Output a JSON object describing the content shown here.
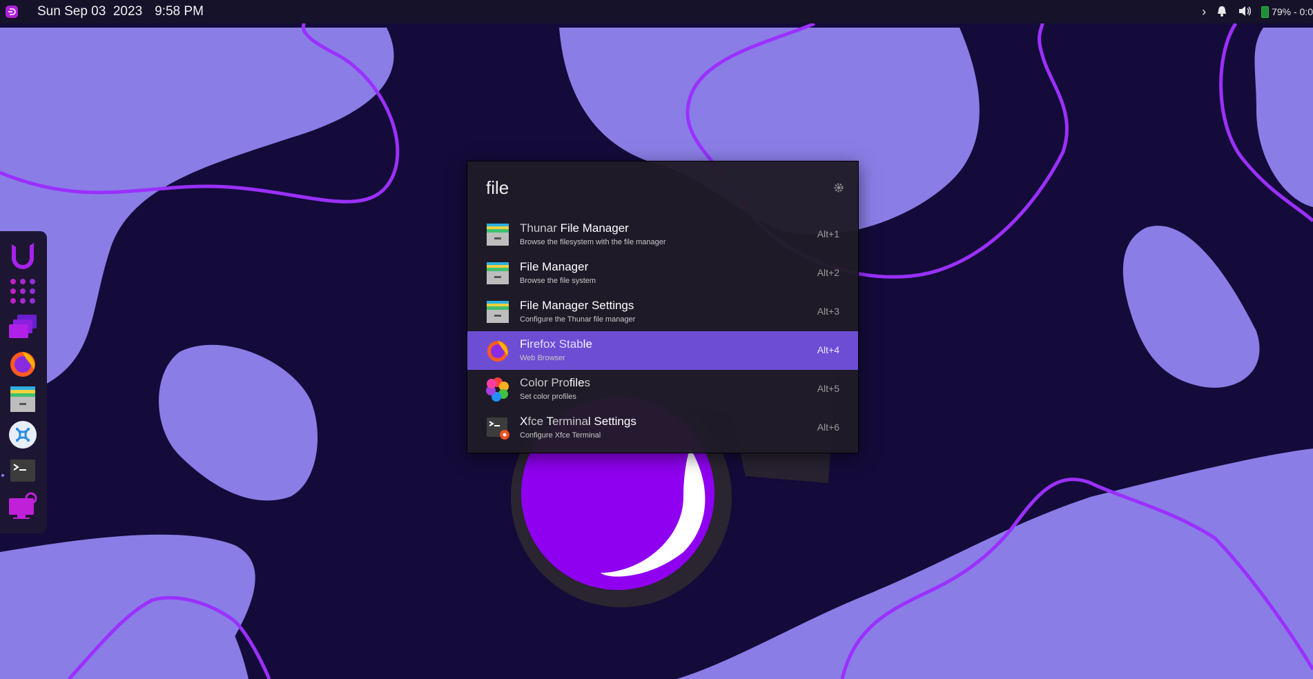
{
  "topbar": {
    "date": "Sun Sep 03  2023",
    "time": "9:58 PM",
    "battery": "79% - 0:0",
    "icons": [
      "menu-icon",
      "chevron-right-icon",
      "bell-icon",
      "volume-icon",
      "battery-icon"
    ]
  },
  "dock": {
    "items": [
      "ultramarine-logo-icon",
      "app-grid-icon",
      "workspaces-icon",
      "firefox-icon",
      "file-manager-icon",
      "settings-manager-icon",
      "terminal-icon",
      "display-settings-icon"
    ]
  },
  "launcher": {
    "query": "file",
    "settings_icon": "gear-icon",
    "results": [
      {
        "name_parts": [
          {
            "t": "Thunar ",
            "hl": false
          },
          {
            "t": "File",
            "hl": true
          },
          {
            "t": " ",
            "hl": false
          },
          {
            "t": "Manager",
            "hl": true
          }
        ],
        "desc": "Browse the filesystem with the file manager",
        "hotkey": "Alt+1",
        "icon": "file-manager-icon",
        "selected": false
      },
      {
        "name_parts": [
          {
            "t": "File",
            "hl": true
          },
          {
            "t": " ",
            "hl": false
          },
          {
            "t": "Manager",
            "hl": true
          }
        ],
        "desc": "Browse the file system",
        "hotkey": "Alt+2",
        "icon": "file-manager-icon",
        "selected": false
      },
      {
        "name_parts": [
          {
            "t": "File",
            "hl": true
          },
          {
            "t": " ",
            "hl": false
          },
          {
            "t": "Manager Settings",
            "hl": true
          }
        ],
        "desc": "Configure the Thunar file manager",
        "hotkey": "Alt+3",
        "icon": "file-manager-icon",
        "selected": false
      },
      {
        "name_parts": [
          {
            "t": "Fi",
            "hl": true
          },
          {
            "t": "refox Stab",
            "hl": false
          },
          {
            "t": "le",
            "hl": true
          }
        ],
        "desc": "Web Browser",
        "hotkey": "Alt+4",
        "icon": "firefox-icon",
        "selected": true
      },
      {
        "name_parts": [
          {
            "t": "Color Pro",
            "hl": false
          },
          {
            "t": "file",
            "hl": true
          },
          {
            "t": "s",
            "hl": false
          }
        ],
        "desc": "Set color profiles",
        "hotkey": "Alt+5",
        "icon": "color-profiles-icon",
        "selected": false
      },
      {
        "name_parts": [
          {
            "t": "X",
            "hl": true
          },
          {
            "t": "fce ",
            "hl": false
          },
          {
            "t": "T",
            "hl": true
          },
          {
            "t": "ermina",
            "hl": false
          },
          {
            "t": "l",
            "hl": true
          },
          {
            "t": " Settings",
            "hl": true
          }
        ],
        "desc": "Configure Xfce Terminal",
        "hotkey": "Alt+6",
        "icon": "terminal-settings-icon",
        "selected": false
      }
    ]
  },
  "colors": {
    "background": "#140b3a",
    "blob": "#8a7de6",
    "line": "#9b30ff",
    "selection": "#6c4dd3",
    "launcher_bg": "#201b28"
  }
}
